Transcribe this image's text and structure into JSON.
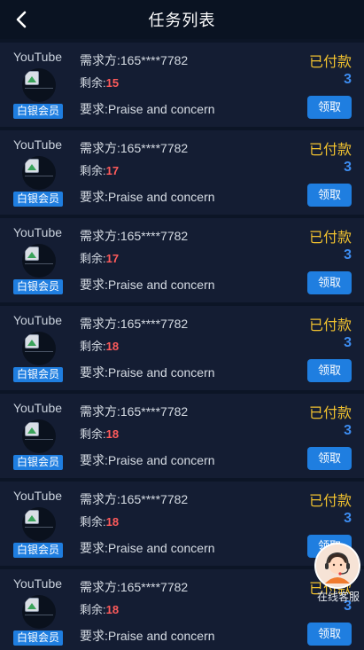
{
  "header": {
    "title": "任务列表",
    "back_icon": "chevron-left-icon"
  },
  "tasks": [
    {
      "platform": "YouTube",
      "member_badge": "白银会员",
      "requester": "需求方:165****7782",
      "remaining_label": "剩余:",
      "remaining_value": "15",
      "requirement": "要求:Praise and concern",
      "payment_status": "已付款",
      "count": "3",
      "claim_label": "领取"
    },
    {
      "platform": "YouTube",
      "member_badge": "白银会员",
      "requester": "需求方:165****7782",
      "remaining_label": "剩余:",
      "remaining_value": "17",
      "requirement": "要求:Praise and concern",
      "payment_status": "已付款",
      "count": "3",
      "claim_label": "领取"
    },
    {
      "platform": "YouTube",
      "member_badge": "白银会员",
      "requester": "需求方:165****7782",
      "remaining_label": "剩余:",
      "remaining_value": "17",
      "requirement": "要求:Praise and concern",
      "payment_status": "已付款",
      "count": "3",
      "claim_label": "领取"
    },
    {
      "platform": "YouTube",
      "member_badge": "白银会员",
      "requester": "需求方:165****7782",
      "remaining_label": "剩余:",
      "remaining_value": "18",
      "requirement": "要求:Praise and concern",
      "payment_status": "已付款",
      "count": "3",
      "claim_label": "领取"
    },
    {
      "platform": "YouTube",
      "member_badge": "白银会员",
      "requester": "需求方:165****7782",
      "remaining_label": "剩余:",
      "remaining_value": "18",
      "requirement": "要求:Praise and concern",
      "payment_status": "已付款",
      "count": "3",
      "claim_label": "领取"
    },
    {
      "platform": "YouTube",
      "member_badge": "白银会员",
      "requester": "需求方:165****7782",
      "remaining_label": "剩余:",
      "remaining_value": "18",
      "requirement": "要求:Praise and concern",
      "payment_status": "已付款",
      "count": "3",
      "claim_label": "领取"
    },
    {
      "platform": "YouTube",
      "member_badge": "白银会员",
      "requester": "需求方:165****7782",
      "remaining_label": "剩余:",
      "remaining_value": "18",
      "requirement": "要求:Praise and concern",
      "payment_status": "已付款",
      "count": "3",
      "claim_label": "领取"
    }
  ],
  "online_service": {
    "label": "在线客服",
    "icon": "customer-service-icon"
  },
  "colors": {
    "background": "#0c1526",
    "card": "#141d33",
    "accent": "#1f7ee0",
    "paid": "#f0c12f",
    "remaining": "#ff5b5b",
    "count": "#3d8cf0"
  }
}
